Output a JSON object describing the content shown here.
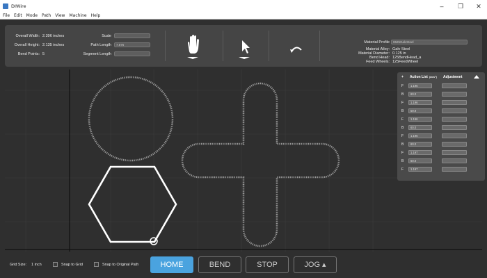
{
  "window": {
    "title": "DIWire",
    "minimize": "–",
    "maximize": "❐",
    "close": "✕"
  },
  "menu": [
    "File",
    "Edit",
    "Mode",
    "Path",
    "View",
    "Machine",
    "Help"
  ],
  "info": {
    "overall_width_label": "Overall Width:",
    "overall_width": "2.396 inches",
    "overall_height_label": "Overall Height:",
    "overall_height": "2.135 inches",
    "bend_points_label": "Bend Points:",
    "bend_points": "5"
  },
  "fields": {
    "scale_label": "Scale",
    "scale_value": "",
    "path_length_label": "Path Length",
    "path_length_value": "7.876",
    "segment_length_label": "Segment Length",
    "segment_length_value": ""
  },
  "tools": {
    "hand": "hand-icon",
    "select": "cursor-arrow-icon",
    "undo": "undo-arc-icon"
  },
  "material": {
    "profile_label": "Material Profile",
    "profile_value": "0625GalvSteel",
    "alloy_label": "Material Alloy:",
    "alloy_value": "Galv Steel",
    "diameter_label": "Material Diameter:",
    "diameter_value": "0.125 in",
    "bend_head_label": "Bend Head:",
    "bend_head_value": "125BendHead_a",
    "feed_wheels_label": "Feed Wheels:",
    "feed_wheels_value": "125FeedWheel"
  },
  "action_list": {
    "col0": "+",
    "col1": "Action List",
    "col1_unit": "(mm/°)",
    "col2": "Adjustment",
    "rows": [
      {
        "type": "F",
        "value": "1.196",
        "adj": ""
      },
      {
        "type": "B",
        "value": "60.0",
        "adj": ""
      },
      {
        "type": "F",
        "value": "1.196",
        "adj": ""
      },
      {
        "type": "B",
        "value": "59.9",
        "adj": ""
      },
      {
        "type": "F",
        "value": "1.196",
        "adj": ""
      },
      {
        "type": "B",
        "value": "60.0",
        "adj": ""
      },
      {
        "type": "F",
        "value": "1.196",
        "adj": ""
      },
      {
        "type": "B",
        "value": "60.0",
        "adj": ""
      },
      {
        "type": "F",
        "value": "1.197",
        "adj": ""
      },
      {
        "type": "B",
        "value": "60.0",
        "adj": ""
      },
      {
        "type": "F",
        "value": "1.197",
        "adj": ""
      }
    ]
  },
  "bottom": {
    "grid_size_label": "Grid Size:",
    "grid_size_value": "1 inch",
    "snap_grid": "Snap to Grid",
    "snap_path": "Snap to Original Path",
    "home": "HOME",
    "bend": "BEND",
    "stop": "STOP",
    "jog": "JOG ▴"
  },
  "colors": {
    "accent": "#4aa3df",
    "panel": "#454545",
    "canvas": "#2f2f2f"
  }
}
